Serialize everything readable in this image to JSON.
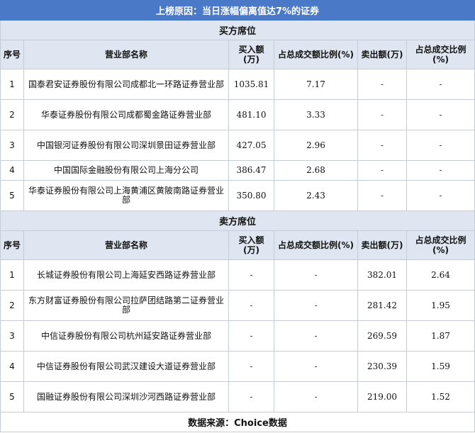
{
  "title": "上榜原因：当日涨幅偏离值达7%的证券",
  "buy_section": {
    "label": "买方席位",
    "headers": {
      "seq": "序号",
      "name": "营业部名称",
      "buy": "买入额(万)",
      "buy_pct": "占总成交额比例(%)",
      "sell": "卖出额(万)",
      "sell_pct": "占总成交比例(%)"
    },
    "rows": [
      {
        "seq": "1",
        "name": "国泰君安证券股份有限公司成都北一环路证券营业部",
        "buy": "1035.81",
        "buy_pct": "7.17",
        "sell": "-",
        "sell_pct": "-"
      },
      {
        "seq": "2",
        "name": "华泰证券股份有限公司成都蜀金路证券营业部",
        "buy": "481.10",
        "buy_pct": "3.33",
        "sell": "-",
        "sell_pct": "-"
      },
      {
        "seq": "3",
        "name": "中国银河证券股份有限公司深圳景田证券营业部",
        "buy": "427.05",
        "buy_pct": "2.96",
        "sell": "-",
        "sell_pct": "-"
      },
      {
        "seq": "4",
        "name": "中国国际金融股份有限公司上海分公司",
        "buy": "386.47",
        "buy_pct": "2.68",
        "sell": "-",
        "sell_pct": "-"
      },
      {
        "seq": "5",
        "name": "华泰证券股份有限公司上海黄浦区黄陂南路证券营业部",
        "buy": "350.80",
        "buy_pct": "2.43",
        "sell": "-",
        "sell_pct": "-"
      }
    ]
  },
  "sell_section": {
    "label": "卖方席位",
    "headers": {
      "seq": "序号",
      "name": "营业部名称",
      "buy": "买入额(万)",
      "buy_pct": "占总成交额比例(%)",
      "sell": "卖出额(万)",
      "sell_pct": "占总成交比例(%)"
    },
    "rows": [
      {
        "seq": "1",
        "name": "长城证券股份有限公司上海延安西路证券营业部",
        "buy": "-",
        "buy_pct": "-",
        "sell": "382.01",
        "sell_pct": "2.64"
      },
      {
        "seq": "2",
        "name": "东方财富证券股份有限公司拉萨团结路第二证券营业部",
        "buy": "-",
        "buy_pct": "-",
        "sell": "281.42",
        "sell_pct": "1.95"
      },
      {
        "seq": "3",
        "name": "中信证券股份有限公司杭州延安路证券营业部",
        "buy": "-",
        "buy_pct": "-",
        "sell": "269.59",
        "sell_pct": "1.87"
      },
      {
        "seq": "4",
        "name": "中信证券股份有限公司武汉建设大道证券营业部",
        "buy": "-",
        "buy_pct": "-",
        "sell": "230.39",
        "sell_pct": "1.59"
      },
      {
        "seq": "5",
        "name": "国融证券股份有限公司深圳沙河西路证券营业部",
        "buy": "-",
        "buy_pct": "-",
        "sell": "219.00",
        "sell_pct": "1.52"
      }
    ]
  },
  "footer": "数据来源：Choice数据"
}
